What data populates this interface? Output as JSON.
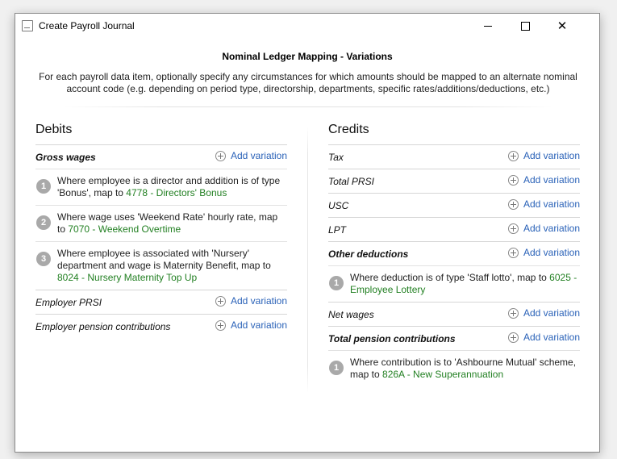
{
  "window": {
    "title": "Create Payroll Journal",
    "minimize_glyph": "",
    "close_glyph": "✕"
  },
  "header": {
    "title": "Nominal Ledger Mapping - Variations",
    "description": "For each payroll data item, optionally specify any circumstances for which amounts should be mapped to an alternate nominal account code (e.g. depending on period type, directorship, departments, specific rates/additions/deductions, etc.)"
  },
  "add_variation_label": "Add variation",
  "debits": {
    "heading": "Debits",
    "gross_wages": {
      "label": "Gross wages",
      "variations": [
        {
          "num": "1",
          "text": "Where employee is a director and addition is of type 'Bonus', map to ",
          "account": "4778 - Directors' Bonus"
        },
        {
          "num": "2",
          "text": "Where wage uses 'Weekend Rate' hourly rate, map to ",
          "account": "7070 - Weekend Overtime"
        },
        {
          "num": "3",
          "text": "Where employee is associated with 'Nursery' department and wage is Maternity Benefit, map to ",
          "account": "8024 - Nursery Maternity Top Up"
        }
      ]
    },
    "employer_prsi": {
      "label": "Employer PRSI"
    },
    "employer_pension": {
      "label": "Employer pension contributions"
    }
  },
  "credits": {
    "heading": "Credits",
    "tax": {
      "label": "Tax"
    },
    "total_prsi": {
      "label": "Total PRSI"
    },
    "usc": {
      "label": "USC"
    },
    "lpt": {
      "label": "LPT"
    },
    "other_deductions": {
      "label": "Other deductions",
      "variations": [
        {
          "num": "1",
          "text": "Where deduction is of type 'Staff lotto', map to ",
          "account": "6025 - Employee Lottery"
        }
      ]
    },
    "net_wages": {
      "label": "Net wages"
    },
    "total_pension": {
      "label": "Total pension contributions",
      "variations": [
        {
          "num": "1",
          "text": "Where contribution is to 'Ashbourne Mutual' scheme, map to ",
          "account": "826A - New Superannuation"
        }
      ]
    }
  },
  "colors": {
    "link": "#2a62b8",
    "account": "#238023",
    "badge": "#a9a9a9"
  }
}
